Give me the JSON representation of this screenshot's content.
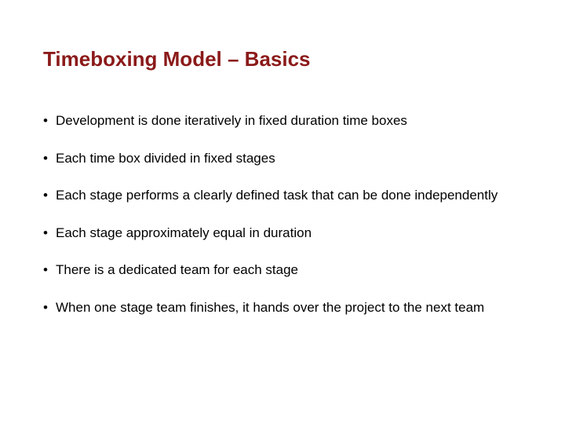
{
  "title": "Timeboxing Model – Basics",
  "bullets": [
    "Development is done iteratively in fixed duration time boxes",
    "Each time box divided in fixed stages",
    "Each stage performs a clearly defined task that can be done independently",
    "Each stage approximately equal in duration",
    "There is a dedicated team for each stage",
    "When one stage team finishes, it hands over the project to the next team"
  ]
}
